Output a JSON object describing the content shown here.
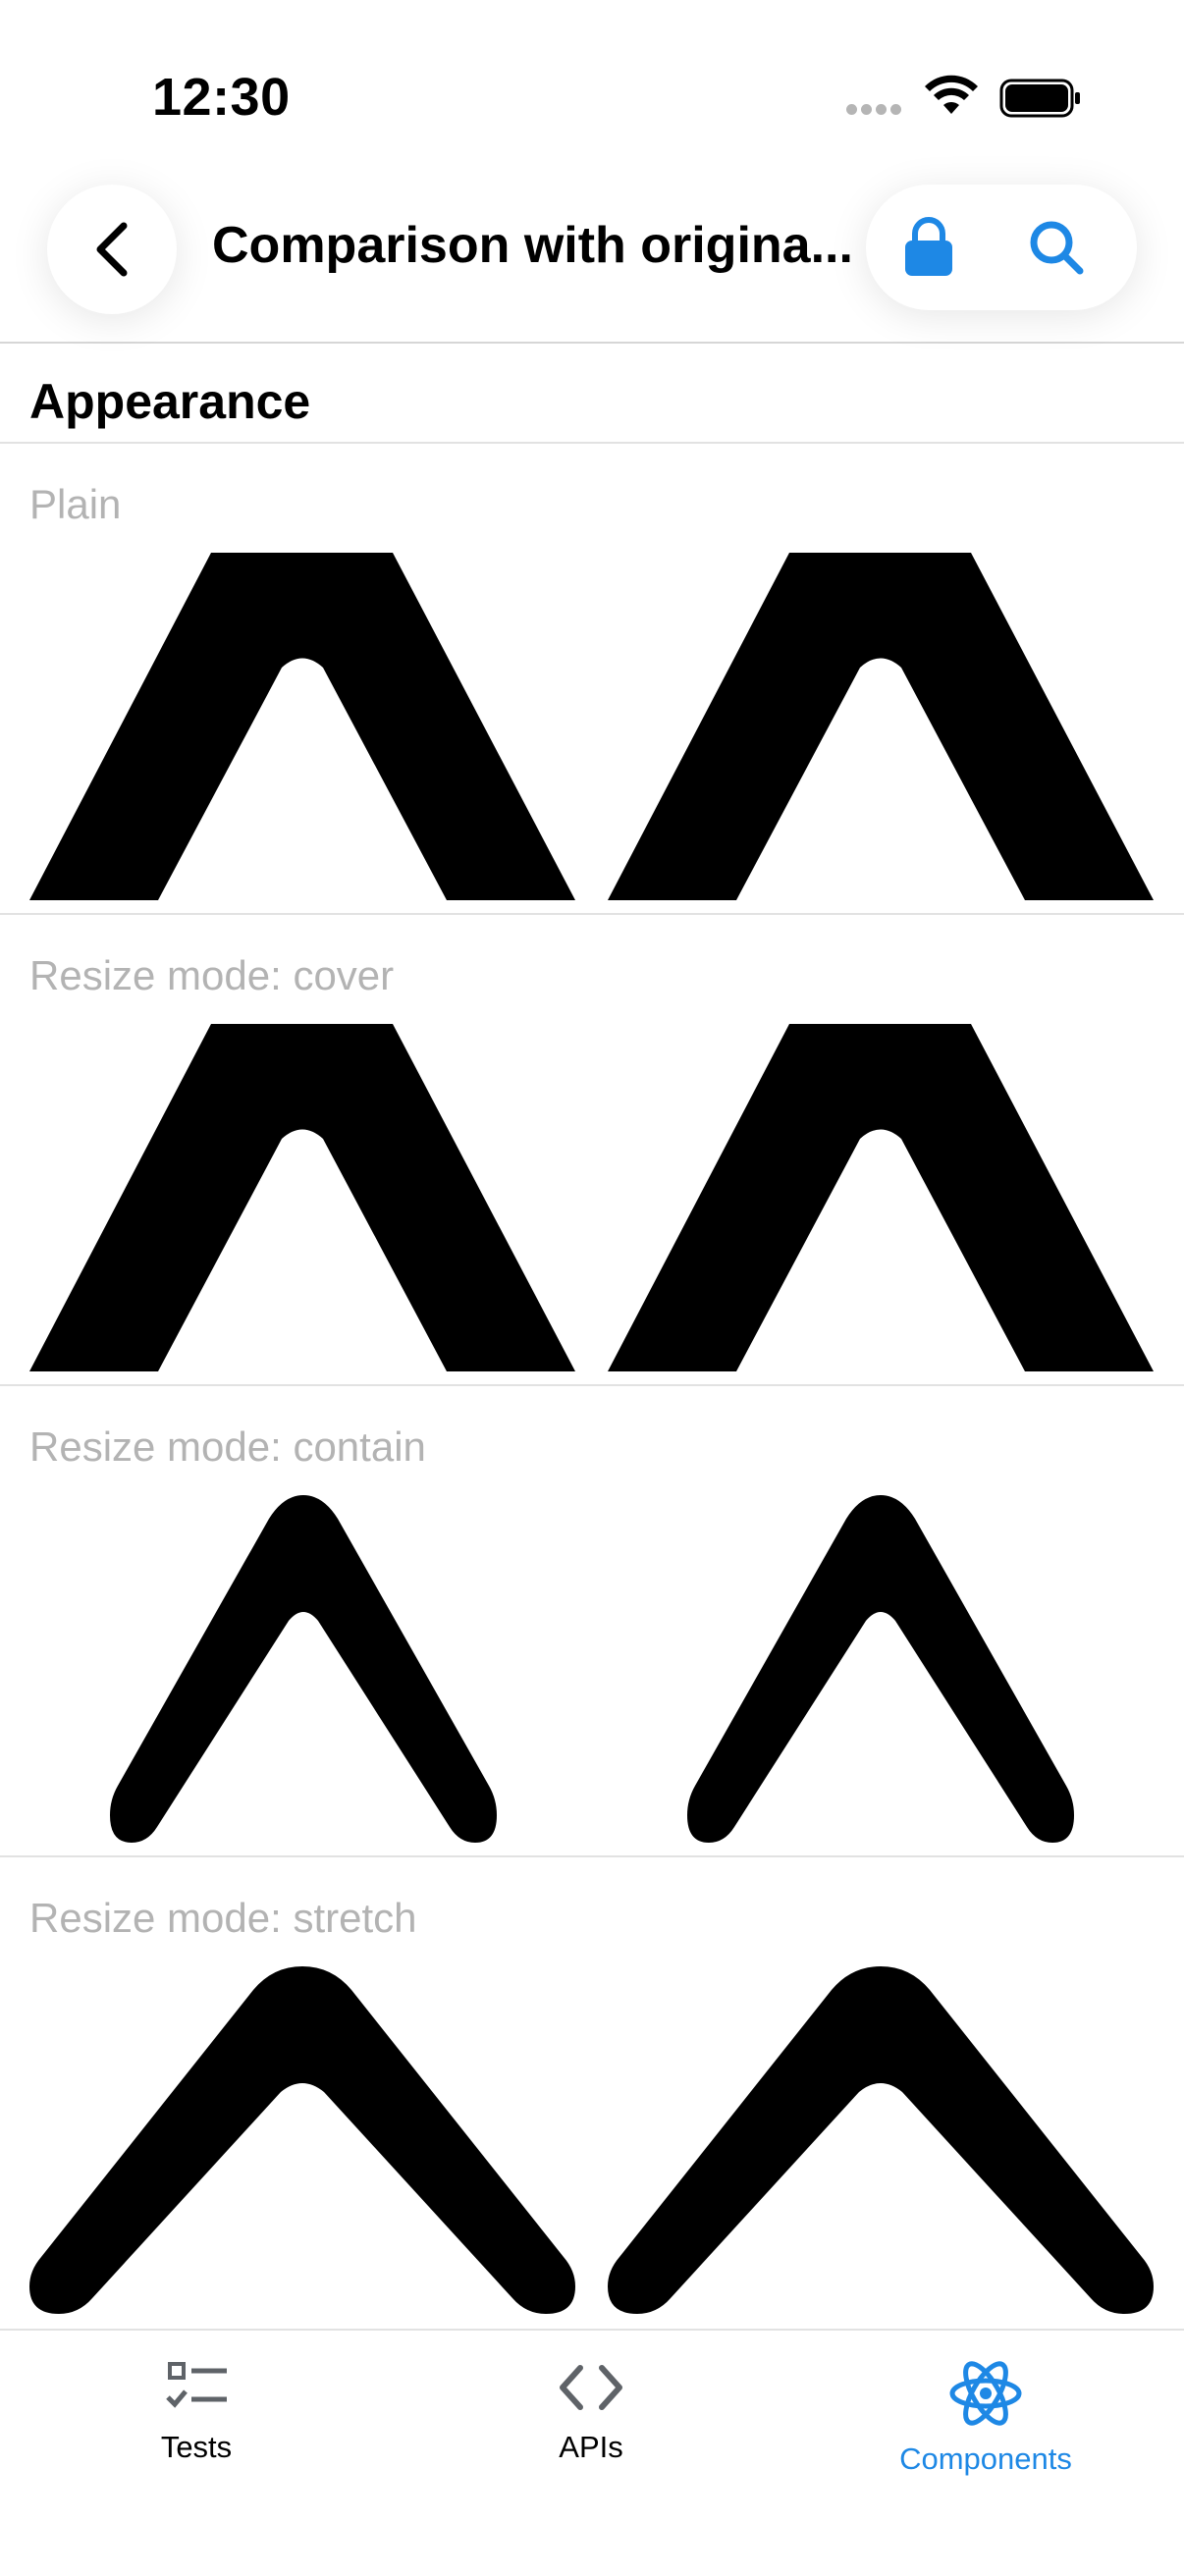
{
  "status_bar": {
    "time": "12:30"
  },
  "header": {
    "title": "Comparison with origina..."
  },
  "section": {
    "title": "Appearance"
  },
  "rows": [
    {
      "label": "Plain"
    },
    {
      "label": "Resize mode: cover"
    },
    {
      "label": "Resize mode: contain"
    },
    {
      "label": "Resize mode: stretch"
    }
  ],
  "tabs": [
    {
      "label": "Tests",
      "icon": "tests-checklist-icon"
    },
    {
      "label": "APIs",
      "icon": "code-brackets-icon"
    },
    {
      "label": "Components",
      "icon": "react-atom-icon",
      "active": true
    }
  ],
  "colors": {
    "accent": "#1E88E5",
    "inactive_tab": "#5f6368",
    "label_gray": "#b3b3b3"
  }
}
